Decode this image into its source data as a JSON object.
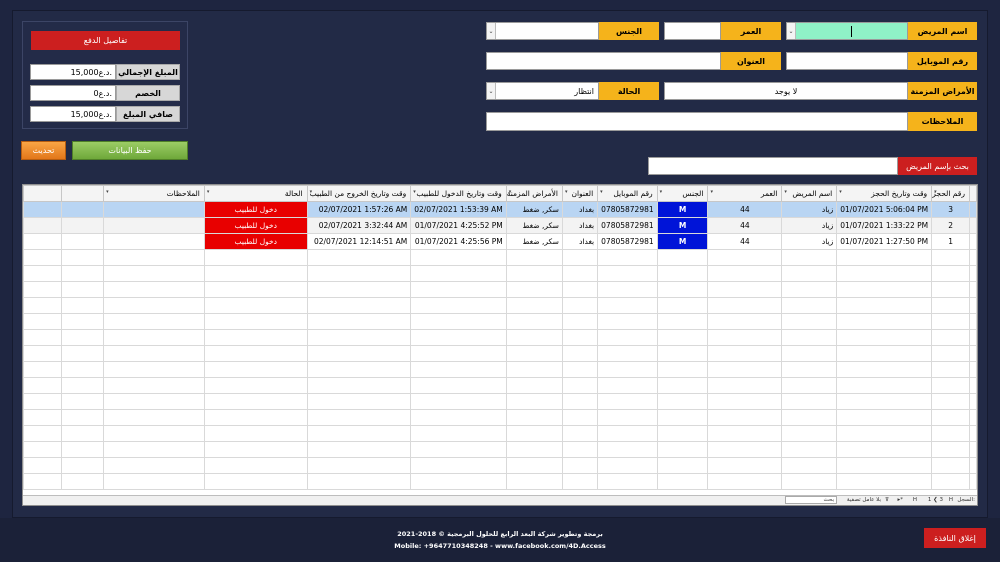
{
  "form": {
    "patient_name_label": "اسم المريض",
    "patient_name_value": "",
    "age_label": "العمر",
    "age_value": "",
    "gender_label": "الجنس",
    "gender_value": "",
    "mobile_label": "رقم الموبايل",
    "mobile_value": "",
    "address_label": "العنوان",
    "address_value": "",
    "chronic_label": "الأمراض المزمنة",
    "chronic_value": "لا يوجد",
    "status_label": "الحالة",
    "status_value": "انتظار",
    "notes_label": "الملاحظات",
    "notes_value": "",
    "search_label": "بحث بإسم المريض",
    "search_value": ""
  },
  "payment": {
    "title": "تفاصيل الدفع",
    "total_label": "المبلغ الإجمالي",
    "total_value": "15,000د.ع.",
    "discount_label": "الخصم",
    "discount_value": "0د.ع.",
    "net_label": "صافي المبلغ",
    "net_value": "15,000د.ع.",
    "save_button": "حفظ البيانات",
    "refresh_button": "تحديث"
  },
  "grid": {
    "headers": [
      "رقم الحجز",
      "وقت وتاريخ الحجز",
      "اسم المريض",
      "العمر",
      "الجنس",
      "رقم الموبايل",
      "العنوان",
      "الأمراض المزمنة",
      "وقت وتاريخ الدخول للطبيب",
      "وقت وتاريخ الخروج من الطبيب",
      "الحالة",
      "الملاحظات"
    ],
    "rows": [
      [
        "3",
        "01/07/2021 5:06:04 PM",
        "زياد",
        "44",
        "M",
        "07805872981",
        "بغداد",
        "سكر, ضغط",
        "02/07/2021 1:53:39 AM",
        "02/07/2021 1:57:26 AM",
        "دخول للطبيب",
        ""
      ],
      [
        "2",
        "01/07/2021 1:33:22 PM",
        "زياد",
        "44",
        "M",
        "07805872981",
        "بغداد",
        "سكر, ضغط",
        "01/07/2021 4:25:52 PM",
        "02/07/2021 3:32:44 AM",
        "دخول للطبيب",
        ""
      ],
      [
        "1",
        "01/07/2021 1:27:50 PM",
        "زياد",
        "44",
        "M",
        "07805872981",
        "بغداد",
        "سكر, ضغط",
        "01/07/2021 4:25:56 PM",
        "02/07/2021 12:14:51 AM",
        "دخول للطبيب",
        ""
      ]
    ],
    "nav_record_label": "السجل:",
    "nav_position": "1 ❮ 3",
    "nav_filter": "بلا عامل تصفية",
    "nav_search": "بحث"
  },
  "footer": {
    "close_button": "إغلاق النافذة",
    "credit_line1": "برمجة وتطوير شركة البعد الرابع للحلول البرمجية © 2018-2021",
    "credit_line2": "Mobile: +9647710348248 - www.facebook.com/4D.Access"
  },
  "colors": {
    "background": "#1e2540",
    "label_yellow": "#f5b31b",
    "accent_red": "#cc1f1f",
    "status_red": "#e80000",
    "gender_blue": "#0014d8",
    "save_green": "#7cb342",
    "refresh_orange": "#f08a24"
  }
}
